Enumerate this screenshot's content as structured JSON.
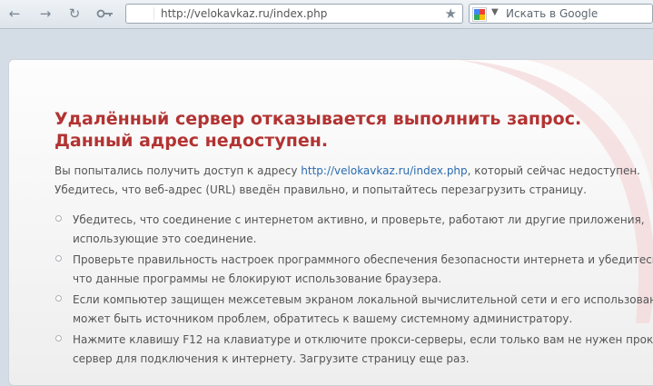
{
  "address_bar": {
    "url": "http://velokavkaz.ru/index.php"
  },
  "search_box": {
    "placeholder": "Искать в Google"
  },
  "error": {
    "title_line1": "Удалённый сервер отказывается выполнить запрос.",
    "title_line2": "Данный адрес недоступен.",
    "intro_prefix": "Вы попытались получить доступ к адресу ",
    "intro_link": "http://velokavkaz.ru/index.php",
    "intro_suffix": ", который сейчас недоступен.",
    "intro_line2": "Убедитесь, что веб-адрес (URL) введён правильно, и попытайтесь перезагрузить страницу.",
    "tips": [
      {
        "line1": "Убедитесь, что соединение с интернетом активно, и проверьте, работают ли другие приложения,",
        "line2": "использующие это соединение."
      },
      {
        "line1": "Проверьте правильность настроек программного обеспечения безопасности интернета и убедитесь,",
        "line2": "что данные программы не блокируют использование браузера."
      },
      {
        "line1": "Если компьютер защищен межсетевым экраном локальной вычислительной сети и его использование",
        "line2": "может быть источником проблем, обратитесь к вашему системному администратору."
      },
      {
        "line1": "Нажмите клавишу F12 на клавиатуре и отключите прокси-серверы, если только вам не нужен прокси-",
        "line2": "сервер для подключения к интернету. Загрузите страницу еще раз."
      }
    ]
  },
  "icons": {
    "back": "arrow-left-icon",
    "forward": "arrow-right-icon",
    "reload": "reload-icon",
    "key": "key-icon",
    "bookmark": "star-icon",
    "search_engine": "google-icon",
    "dropdown": "chevron-down-icon"
  },
  "colors": {
    "title": "#b23332",
    "link": "#2a6bb0",
    "text": "#555555",
    "decoration_red": "#c8232c"
  }
}
